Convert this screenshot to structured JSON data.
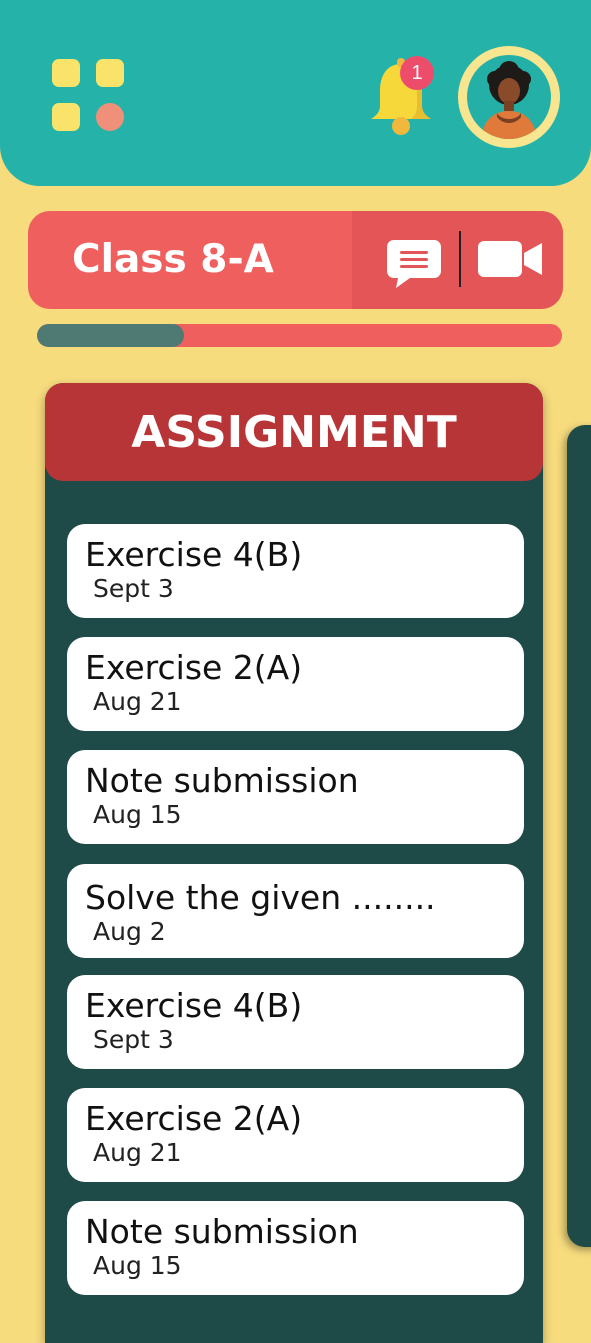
{
  "header": {
    "menu_icon": "grid-apps-icon",
    "notification_icon": "bell-icon",
    "notification_count": "1",
    "avatar_icon": "user-avatar"
  },
  "class_bar": {
    "title": "Class 8-A",
    "chat_icon": "chat-icon",
    "video_icon": "video-camera-icon"
  },
  "progress": {
    "fraction": 0.28
  },
  "assignment": {
    "title": "ASSIGNMENT",
    "items": [
      {
        "title": "Exercise 4(B)",
        "date": "Sept 3"
      },
      {
        "title": "Exercise 2(A)",
        "date": "Aug 21"
      },
      {
        "title": "Note submission",
        "date": "Aug 15"
      },
      {
        "title": "Solve the given ........",
        "date": "Aug 2"
      },
      {
        "title": "Exercise 4(B)",
        "date": "Sept 3"
      },
      {
        "title": "Exercise 2(A)",
        "date": "Aug 21"
      },
      {
        "title": "Note submission",
        "date": "Aug 15"
      }
    ]
  },
  "colors": {
    "background": "#F7DC7E",
    "header": "#25B3A9",
    "class_bar": "#EE5F5E",
    "assignment_header": "#B83537",
    "panel": "#1E4A47",
    "progress_fill": "#4E7A73"
  }
}
